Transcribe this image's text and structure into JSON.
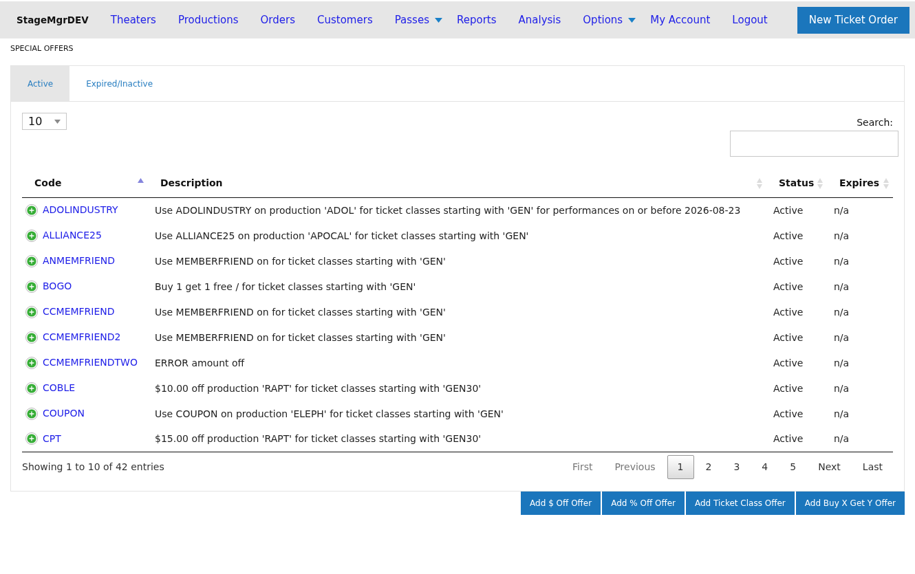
{
  "nav": {
    "brand": "StageMgrDEV",
    "items": [
      {
        "label": "Theaters",
        "has_menu": false
      },
      {
        "label": "Productions",
        "has_menu": false
      },
      {
        "label": "Orders",
        "has_menu": false
      },
      {
        "label": "Customers",
        "has_menu": false
      },
      {
        "label": "Passes",
        "has_menu": true
      },
      {
        "label": "Reports",
        "has_menu": false
      },
      {
        "label": "Analysis",
        "has_menu": false
      },
      {
        "label": "Options",
        "has_menu": true
      },
      {
        "label": "My Account",
        "has_menu": false
      },
      {
        "label": "Logout",
        "has_menu": false
      }
    ],
    "action_button": "New Ticket Order"
  },
  "page_title": "SPECIAL OFFERS",
  "tabs": [
    {
      "label": "Active",
      "selected": true
    },
    {
      "label": "Expired/Inactive",
      "selected": false
    }
  ],
  "page_length": {
    "value": "10"
  },
  "search": {
    "label": "Search:"
  },
  "table": {
    "columns": [
      {
        "label": "Code",
        "sorted": true
      },
      {
        "label": "Description",
        "sorted": false
      },
      {
        "label": "Status",
        "sorted": false
      },
      {
        "label": "Expires",
        "sorted": false
      }
    ],
    "rows": [
      {
        "code": "ADOLINDUSTRY",
        "description": "Use ADOLINDUSTRY on production 'ADOL' for ticket classes starting with 'GEN' for performances on or before 2026-08-23",
        "status": "Active",
        "expires": "n/a"
      },
      {
        "code": "ALLIANCE25",
        "description": "Use ALLIANCE25 on production 'APOCAL' for ticket classes starting with 'GEN'",
        "status": "Active",
        "expires": "n/a"
      },
      {
        "code": "ANMEMFRIEND",
        "description": "Use MEMBERFRIEND on for ticket classes starting with 'GEN'",
        "status": "Active",
        "expires": "n/a"
      },
      {
        "code": "BOGO",
        "description": "Buy 1 get 1 free / for ticket classes starting with 'GEN'",
        "status": "Active",
        "expires": "n/a"
      },
      {
        "code": "CCMEMFRIEND",
        "description": "Use MEMBERFRIEND on for ticket classes starting with 'GEN'",
        "status": "Active",
        "expires": "n/a"
      },
      {
        "code": "CCMEMFRIEND2",
        "description": "Use MEMBERFRIEND on for ticket classes starting with 'GEN'",
        "status": "Active",
        "expires": "n/a"
      },
      {
        "code": "CCMEMFRIENDTWO",
        "description": "ERROR amount off",
        "status": "Active",
        "expires": "n/a"
      },
      {
        "code": "COBLE",
        "description": "$10.00 off production 'RAPT' for ticket classes starting with 'GEN30'",
        "status": "Active",
        "expires": "n/a"
      },
      {
        "code": "COUPON",
        "description": "Use COUPON on production 'ELEPH' for ticket classes starting with 'GEN'",
        "status": "Active",
        "expires": "n/a"
      },
      {
        "code": "CPT",
        "description": "$15.00 off production 'RAPT' for ticket classes starting with 'GEN30'",
        "status": "Active",
        "expires": "n/a"
      }
    ]
  },
  "info": "Showing 1 to 10 of 42 entries",
  "pagination": [
    {
      "label": "First",
      "selected": false,
      "disabled": true
    },
    {
      "label": "Previous",
      "selected": false,
      "disabled": true
    },
    {
      "label": "1",
      "selected": true,
      "disabled": false
    },
    {
      "label": "2",
      "selected": false,
      "disabled": false
    },
    {
      "label": "3",
      "selected": false,
      "disabled": false
    },
    {
      "label": "4",
      "selected": false,
      "disabled": false
    },
    {
      "label": "5",
      "selected": false,
      "disabled": false
    },
    {
      "label": "Next",
      "selected": false,
      "disabled": false
    },
    {
      "label": "Last",
      "selected": false,
      "disabled": false
    }
  ],
  "actions": [
    "Add $ Off Offer",
    "Add % Off Offer",
    "Add Ticket Class Offer",
    "Add Buy X Get Y Offer"
  ]
}
